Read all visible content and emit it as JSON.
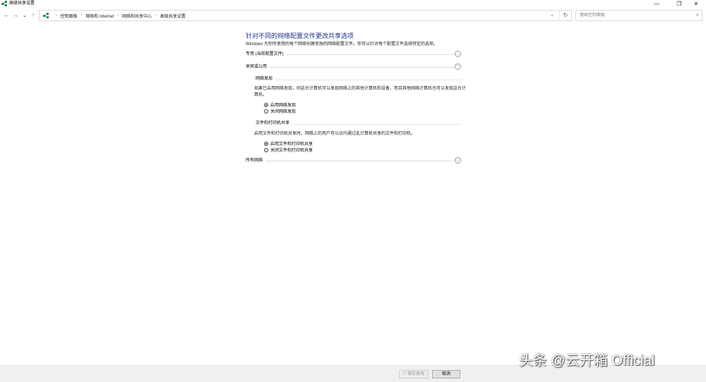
{
  "window": {
    "title": "高级共享设置",
    "minimize": "—",
    "maximize": "❐",
    "close": "✕"
  },
  "nav": {
    "back": "←",
    "forward": "→",
    "recent": "⌄",
    "up": "↑"
  },
  "address": {
    "breadcrumbs": [
      "控制面板",
      "网络和 Internet",
      "网络和共享中心",
      "高级共享设置"
    ],
    "dropdown": "⌄",
    "refresh": "↻"
  },
  "search": {
    "placeholder": "搜索控制面板",
    "icon": "⌕"
  },
  "page": {
    "title": "针对不同的网络配置文件更改共享选项",
    "description": "Windows 为你所使用的每个网络创建单独的网络配置文件。你可以针对每个配置文件选择特定的选项。"
  },
  "sections": {
    "private": {
      "label": "专用 (当前配置文件)",
      "chevron": "⌄"
    },
    "guest": {
      "label": "来宾或公用",
      "chevron": "⌃",
      "discovery": {
        "heading": "网络发现",
        "description": "如果已启用网络发现，则这台计算机可以发现网络上的其他计算机和设备，而且其他网络计算机也可以发现这台计算机。",
        "options": [
          {
            "label": "启用网络发现",
            "selected": true
          },
          {
            "label": "关闭网络发现",
            "selected": false
          }
        ]
      },
      "sharing": {
        "heading": "文件和打印机共享",
        "description": "启用文件和打印机共享时，网络上的用户可以访问通过此计算机共享的文件和打印机。",
        "options": [
          {
            "label": "启用文件和打印机共享",
            "selected": true
          },
          {
            "label": "关闭文件和打印机共享",
            "selected": false
          }
        ]
      }
    },
    "all": {
      "label": "所有网络",
      "chevron": "⌄"
    }
  },
  "footer": {
    "save_label": "保存更改",
    "cancel_label": "取消"
  },
  "watermark": "头条 @云开箱 Official"
}
